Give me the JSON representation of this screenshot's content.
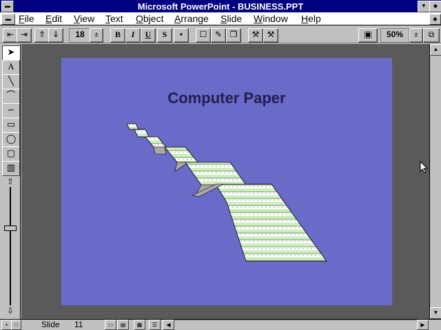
{
  "window": {
    "title": "Microsoft PowerPoint - BUSINESS.PPT"
  },
  "menu": [
    "File",
    "Edit",
    "View",
    "Text",
    "Object",
    "Arrange",
    "Slide",
    "Window",
    "Help"
  ],
  "toolbar": {
    "font_size": "18",
    "bold": "B",
    "italic": "I",
    "underline": "U",
    "shadow": "S",
    "zoom": "50%"
  },
  "slide": {
    "title": "Computer Paper"
  },
  "status": {
    "label": "Slide",
    "number": "11"
  }
}
